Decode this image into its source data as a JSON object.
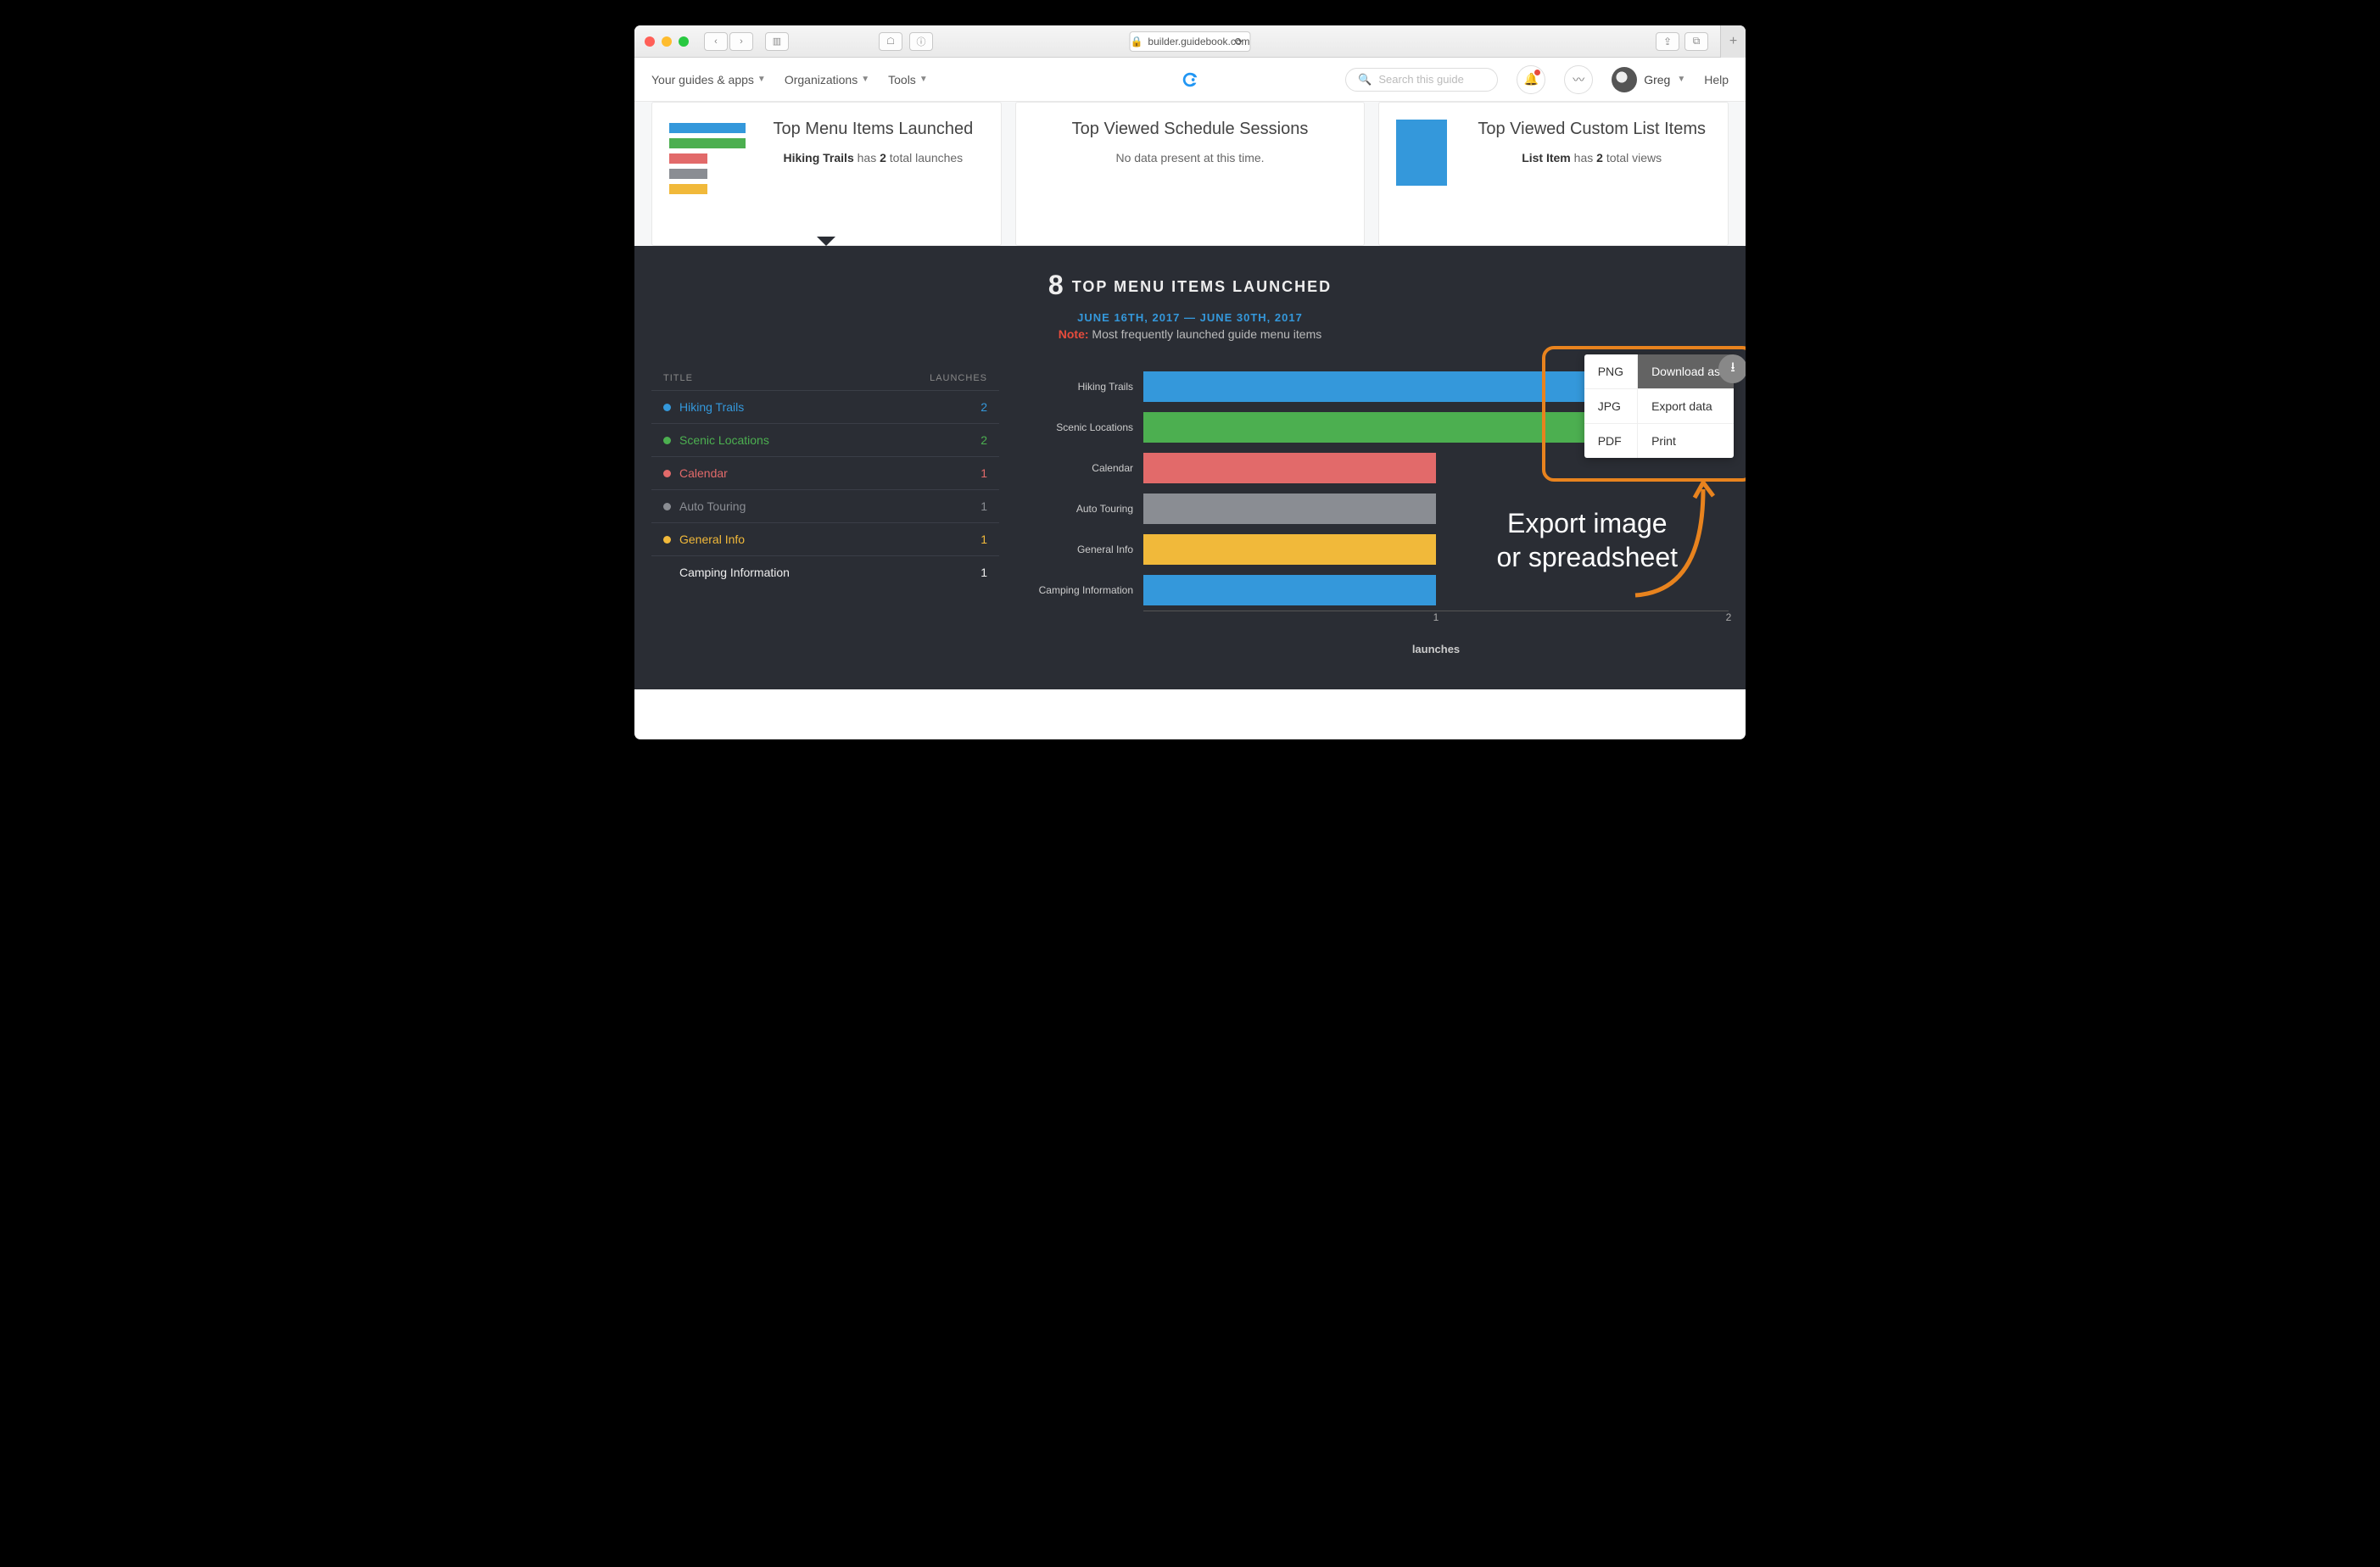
{
  "browser": {
    "url": "builder.guidebook.com"
  },
  "appbar": {
    "menus": [
      "Your guides & apps",
      "Organizations",
      "Tools"
    ],
    "search_placeholder": "Search this guide",
    "user": "Greg",
    "help": "Help"
  },
  "cards": {
    "c1": {
      "title": "Top Menu Items Launched",
      "text_a": "Hiking Trails",
      "text_b": "has",
      "text_c": "2",
      "text_d": "total launches",
      "bars": [
        {
          "w": 90,
          "c": "#3498db"
        },
        {
          "w": 90,
          "c": "#4caf50"
        },
        {
          "w": 45,
          "c": "#e26a6a"
        },
        {
          "w": 45,
          "c": "#8a8d93"
        },
        {
          "w": 45,
          "c": "#f1b93a"
        }
      ]
    },
    "c2": {
      "title": "Top Viewed Schedule Sessions",
      "text": "No data present at this time."
    },
    "c3": {
      "title": "Top Viewed Custom List Items",
      "text_a": "List Item",
      "text_b": "has",
      "text_c": "2",
      "text_d": "total views"
    }
  },
  "dark": {
    "count": "8",
    "title": "TOP MENU ITEMS LAUNCHED",
    "daterange": "JUNE 16TH, 2017 — JUNE 30TH, 2017",
    "note_label": "Note:",
    "note_text": "Most frequently launched guide menu items"
  },
  "table": {
    "head_title": "TITLE",
    "head_launches": "LAUNCHES",
    "rows": [
      {
        "label": "Hiking Trails",
        "value": "2",
        "color": "#3498db",
        "tcolor": "#3498db"
      },
      {
        "label": "Scenic Locations",
        "value": "2",
        "color": "#4caf50",
        "tcolor": "#4caf50"
      },
      {
        "label": "Calendar",
        "value": "1",
        "color": "#e26a6a",
        "tcolor": "#e26a6a"
      },
      {
        "label": "Auto Touring",
        "value": "1",
        "color": "#8a8d93",
        "tcolor": "#8a8d93"
      },
      {
        "label": "General Info",
        "value": "1",
        "color": "#f1b93a",
        "tcolor": "#f1b93a"
      },
      {
        "label": "Camping Information",
        "value": "1",
        "color": "",
        "tcolor": "#eee"
      }
    ]
  },
  "chart_data": {
    "type": "bar",
    "orientation": "horizontal",
    "title": "Top Menu Items Launched",
    "xlabel": "launches",
    "xlim": [
      0,
      2
    ],
    "ticks": [
      1,
      2
    ],
    "categories": [
      "Hiking Trails",
      "Scenic Locations",
      "Calendar",
      "Auto Touring",
      "General Info",
      "Camping Information"
    ],
    "values": [
      2,
      2,
      1,
      1,
      1,
      1
    ],
    "colors": [
      "#3498db",
      "#4caf50",
      "#e26a6a",
      "#8a8d93",
      "#f1b93a",
      "#3498db"
    ]
  },
  "export_menu": {
    "formats": [
      "PNG",
      "JPG",
      "PDF"
    ],
    "actions": [
      "Download as",
      "Export data",
      "Print"
    ],
    "active_action_index": 0
  },
  "annotation": "Export image\nor spreadsheet"
}
